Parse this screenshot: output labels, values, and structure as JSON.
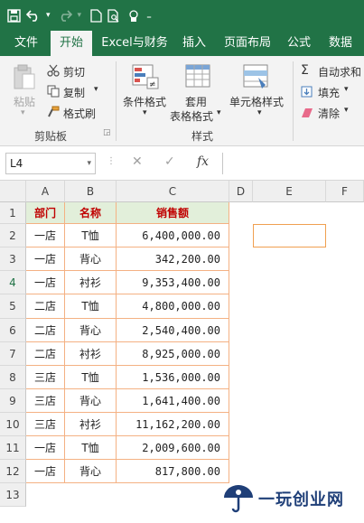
{
  "quick_access": {
    "save_icon": "save-icon",
    "undo_icon": "undo-icon",
    "redo_icon": "redo-icon",
    "new_icon": "new-file-icon",
    "preview_icon": "print-preview-icon",
    "touch_icon": "touch-mode-icon",
    "customize": "₌"
  },
  "tabs": [
    "文件",
    "开始",
    "Excel与财务",
    "插入",
    "页面布局",
    "公式",
    "数据"
  ],
  "active_tab": "开始",
  "ribbon": {
    "paste": "粘贴",
    "cut": "剪切",
    "copy": "复制",
    "format_painter": "格式刷",
    "clipboard_group": "剪贴板",
    "conditional_format": "条件格式",
    "table_format_1": "套用",
    "table_format_2": "表格格式",
    "cell_styles": "单元格样式",
    "styles_group": "样式",
    "autosum": "自动求和",
    "fill": "填充",
    "clear": "清除"
  },
  "formula_bar": {
    "name_box": "L4",
    "cancel": "✕",
    "enter": "✓",
    "fx": "fx",
    "formula": ""
  },
  "columns": [
    "A",
    "B",
    "C",
    "D",
    "E",
    "F"
  ],
  "rows": [
    "1",
    "2",
    "3",
    "4",
    "5",
    "6",
    "7",
    "8",
    "9",
    "10",
    "11",
    "12",
    "13"
  ],
  "table": {
    "headers": [
      "部门",
      "名称",
      "销售额"
    ],
    "data": [
      [
        "一店",
        "T恤",
        "6,400,000.00"
      ],
      [
        "一店",
        "背心",
        "342,200.00"
      ],
      [
        "一店",
        "衬衫",
        "9,353,400.00"
      ],
      [
        "二店",
        "T恤",
        "4,800,000.00"
      ],
      [
        "二店",
        "背心",
        "2,540,400.00"
      ],
      [
        "二店",
        "衬衫",
        "8,925,000.00"
      ],
      [
        "三店",
        "T恤",
        "1,536,000.00"
      ],
      [
        "三店",
        "背心",
        "1,641,400.00"
      ],
      [
        "三店",
        "衬衫",
        "11,162,200.00"
      ],
      [
        "一店",
        "T恤",
        "2,009,600.00"
      ],
      [
        "一店",
        "背心",
        "817,800.00"
      ]
    ]
  },
  "watermark": {
    "text": "一玩创业网",
    "logo_icon": "umbrella-logo-icon"
  },
  "colors": {
    "ribbon_green": "#217346",
    "header_fill": "#e2efda",
    "header_text": "#c00000",
    "border_orange": "#f4b183"
  }
}
